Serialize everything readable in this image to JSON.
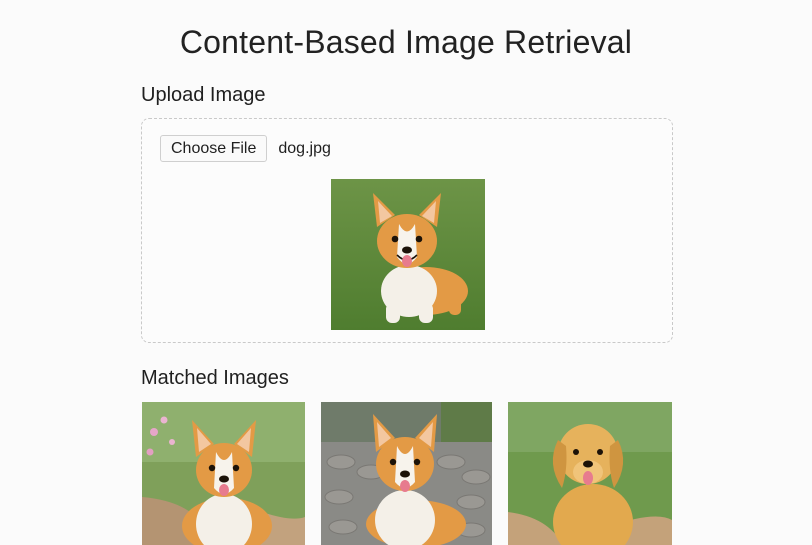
{
  "page": {
    "title": "Content-Based Image Retrieval"
  },
  "upload": {
    "heading": "Upload Image",
    "choose_button_label": "Choose File",
    "file_name": "dog.jpg",
    "preview_alt": "corgi-photo"
  },
  "matched": {
    "heading": "Matched Images",
    "images": [
      {
        "alt": "corgi-on-path-photo"
      },
      {
        "alt": "corgi-on-cobblestone-photo"
      },
      {
        "alt": "golden-retriever-photo"
      }
    ]
  },
  "colors": {
    "background": "#fbfbfb",
    "dashed_border": "#c9c9c9",
    "grass": "#5f8f3a",
    "corgi_orange": "#e39a45",
    "golden_fur": "#e2a94e"
  }
}
